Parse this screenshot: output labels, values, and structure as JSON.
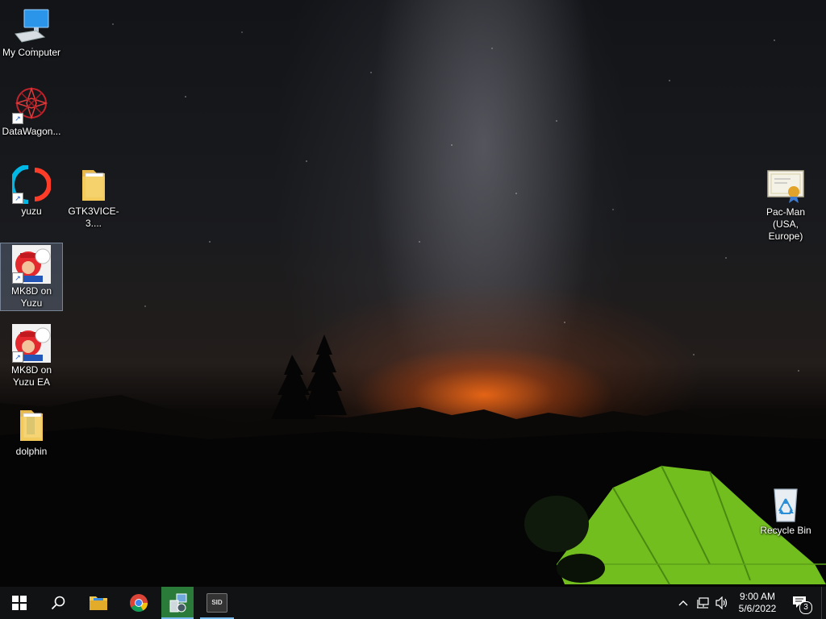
{
  "desktop": {
    "icons": {
      "my_computer": "My Computer",
      "datawagon": "DataWagon...",
      "yuzu": "yuzu",
      "gtk3vice": "GTK3VICE-3....",
      "mk8d_yuzu_1": "MK8D on",
      "mk8d_yuzu_2": "Yuzu",
      "mk8d_ea_1": "MK8D on",
      "mk8d_ea_2": "Yuzu EA",
      "dolphin": "dolphin",
      "pacman_1": "Pac-Man",
      "pacman_2": "(USA, Europe)",
      "recycle_bin": "Recycle Bin"
    }
  },
  "taskbar": {
    "start_icon": "windows-logo",
    "search_icon": "search",
    "apps": [
      "file-explorer",
      "chrome",
      "network-tool",
      "sid"
    ],
    "sid_label": "SID",
    "clock": {
      "time": "9:00 AM",
      "date": "5/6/2022"
    },
    "notification_count": "3"
  },
  "colors": {
    "taskbar_bg": "#101214",
    "active_app": "#2a7a3a",
    "tent_green": "#7ed321"
  }
}
